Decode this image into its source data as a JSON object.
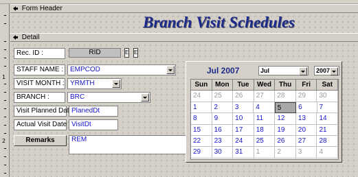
{
  "form_header": {
    "label": "Form Header",
    "title": "Branch Visit Schedules"
  },
  "detail": {
    "label": "Detail"
  },
  "ruler": {
    "marks": [
      "1",
      "2"
    ]
  },
  "fields": {
    "rec_id_label": "Rec. ID :",
    "rec_id_value": "RID",
    "tiny_a": "E",
    "tiny_b": "E",
    "staff_label": "STAFF  NAME :",
    "staff_value": "EMPCOD",
    "visit_month_label": "VISIT MONTH :",
    "visit_month_value": "YRMTH",
    "branch_label": "BRANCH :",
    "branch_value": "BRC",
    "planned_label": "Visit Planned Date :",
    "planned_value": "PlanedDt",
    "actual_label": "Actual Visit Date :",
    "actual_value": "VisitDt",
    "remarks_label": "Remarks",
    "remarks_value": "REM"
  },
  "calendar": {
    "heading": "Jul 2007",
    "month_select": "Jul",
    "year_select": "2007",
    "days_of_week": [
      "Sun",
      "Mon",
      "Tue",
      "Wed",
      "Thu",
      "Fri",
      "Sat"
    ],
    "weeks": [
      [
        "24",
        "25",
        "26",
        "27",
        "28",
        "29",
        "30"
      ],
      [
        "1",
        "2",
        "3",
        "4",
        "5",
        "6",
        "7"
      ],
      [
        "8",
        "9",
        "10",
        "11",
        "12",
        "13",
        "14"
      ],
      [
        "15",
        "16",
        "17",
        "18",
        "19",
        "20",
        "21"
      ],
      [
        "22",
        "23",
        "24",
        "25",
        "26",
        "27",
        "28"
      ],
      [
        "29",
        "30",
        "31",
        "1",
        "2",
        "3",
        "4"
      ]
    ],
    "selected_day": "5"
  },
  "colors": {
    "title": "#1c2a8c",
    "field_text": "#1515c8",
    "form_bg": "#d4d0c8"
  }
}
